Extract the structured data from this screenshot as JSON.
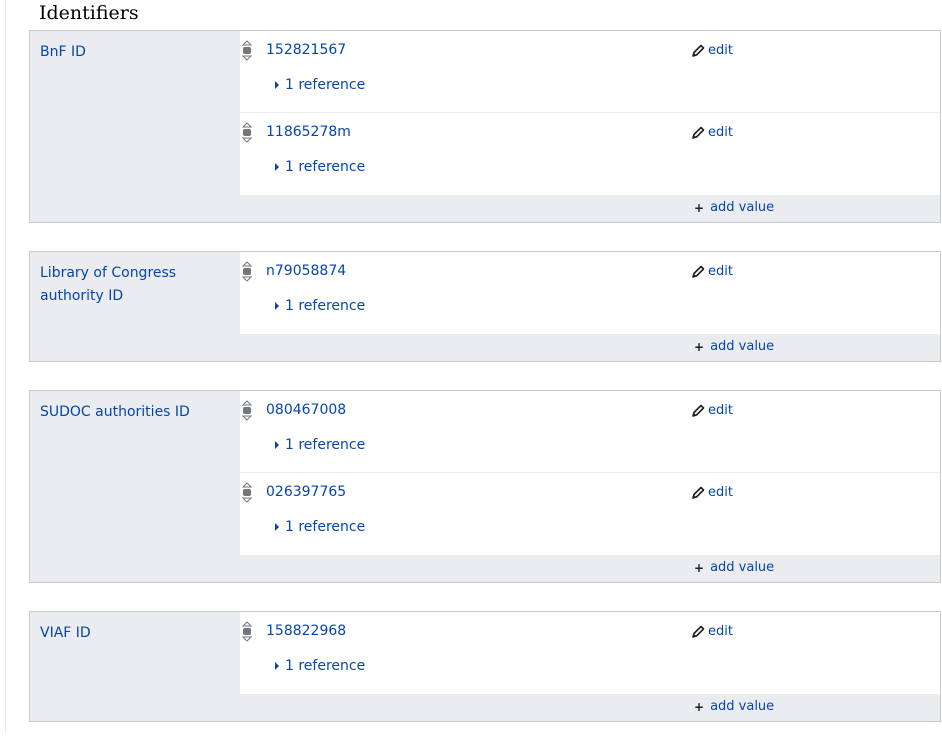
{
  "section": {
    "title": "Identifiers"
  },
  "labels": {
    "edit": "edit",
    "add_value": "add value"
  },
  "icons": {
    "rank": "rank-normal-icon",
    "edit": "pencil-icon",
    "expand": "triangle-right-icon",
    "add": "plus-icon"
  },
  "colors": {
    "link": "#0645ad",
    "group_background": "#eaecf0",
    "border": "#c8ccd1"
  },
  "groups": [
    {
      "label": "BnF ID",
      "statements": [
        {
          "value": "152821567",
          "reference": "1 reference"
        },
        {
          "value": "11865278m",
          "reference": "1 reference"
        }
      ]
    },
    {
      "label": "Library of Congress authority ID",
      "statements": [
        {
          "value": "n79058874",
          "reference": "1 reference"
        }
      ]
    },
    {
      "label": "SUDOC authorities ID",
      "statements": [
        {
          "value": "080467008",
          "reference": "1 reference"
        },
        {
          "value": "026397765",
          "reference": "1 reference"
        }
      ]
    },
    {
      "label": "VIAF ID",
      "statements": [
        {
          "value": "158822968",
          "reference": "1 reference"
        }
      ]
    }
  ]
}
